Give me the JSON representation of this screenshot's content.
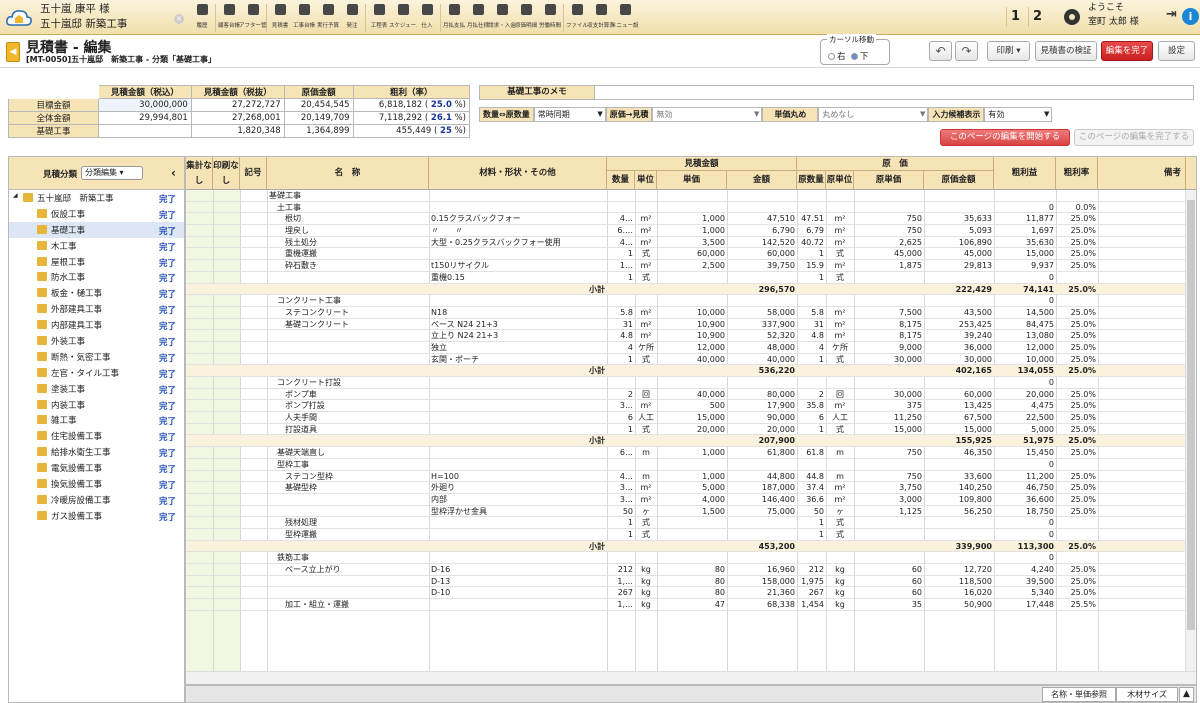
{
  "header": {
    "project_line1": "五十嵐 康平 様",
    "project_line2": "五十嵐邸 新築工事",
    "tools": [
      {
        "icon": "undo-icon",
        "label": "履歴"
      },
      {
        "icon": "customer-icon",
        "label": "顧客台帳"
      },
      {
        "icon": "list-icon",
        "label": "アフター管理"
      },
      {
        "icon": "document-icon",
        "label": "見積書"
      },
      {
        "icon": "house-icon",
        "label": "工事台帳"
      },
      {
        "icon": "calculator-icon",
        "label": "実行予算"
      },
      {
        "icon": "send-icon",
        "label": "発注"
      },
      {
        "icon": "table-icon",
        "label": "工程表"
      },
      {
        "icon": "calendar-icon",
        "label": "スケジュール"
      },
      {
        "icon": "cart-icon",
        "label": "仕入"
      },
      {
        "icon": "bank-icon",
        "label": "月払支払"
      },
      {
        "icon": "truck-icon",
        "label": "月払仕様"
      },
      {
        "icon": "invoice-icon",
        "label": "請求・入金"
      },
      {
        "icon": "tag-icon",
        "label": "原価明細"
      },
      {
        "icon": "car-icon",
        "label": "労働時間"
      },
      {
        "icon": "file-icon",
        "label": "ファイル"
      },
      {
        "icon": "calc-icon",
        "label": "収支計算表"
      },
      {
        "icon": "wrench-icon",
        "label": "メニュー設定"
      }
    ],
    "page_btn_1": "1",
    "page_btn_2": "2",
    "welcome": "ようこそ",
    "user": "室町 太郎 様"
  },
  "title": {
    "main": "見積書 - 編集",
    "sub": "[MT-0050]五十嵐邸　新築工事 - 分類「基礎工事」"
  },
  "cursor": {
    "label": "カーソル移動",
    "opt_right": "右",
    "opt_down": "下"
  },
  "buttons": {
    "print": "印刷 ▾",
    "verify": "見積書の検証",
    "finish": "編集を完了",
    "settings": "設定",
    "start_edit": "このページの編集を開始する",
    "end_edit": "このページの編集を完了する",
    "name_ref": "名称・単価参照",
    "wood_size": "木材サイズ"
  },
  "totals": {
    "headers": [
      "見積金額（税込）",
      "見積金額（税抜）",
      "原価金額",
      "粗利（率）"
    ],
    "rows": [
      {
        "label": "目標金額",
        "v1": "30,000,000",
        "v2": "27,272,727",
        "v3": "20,454,545",
        "v4": "6,818,182 (",
        "rate": "25.0",
        "pct": "%)"
      },
      {
        "label": "全体金額",
        "v1": "29,994,801",
        "v2": "27,268,001",
        "v3": "20,149,709",
        "v4": "7,118,292 (",
        "rate": "26.1",
        "pct": "%)"
      },
      {
        "label": "基礎工事",
        "v1": "",
        "v2": "1,820,348",
        "v3": "1,364,899",
        "v4": "455,449 (",
        "rate": "25",
        "pct": "%)"
      }
    ]
  },
  "memo": {
    "label": "基礎工事のメモ",
    "value": ""
  },
  "options": {
    "qty_label": "数量⇔原数量",
    "qty_value": "常時同期",
    "cost_label": "原価→見積",
    "cost_value": "無効",
    "round_label": "単価丸め",
    "round_value": "丸めなし",
    "input_label": "入力候補表示",
    "input_value": "有効"
  },
  "sidebar": {
    "title": "見積分類",
    "select": "分類編集 ▾",
    "root": "五十嵐邸　新築工事",
    "status": "完了",
    "items": [
      "仮設工事",
      "基礎工事",
      "木工事",
      "屋根工事",
      "防水工事",
      "板金・樋工事",
      "外部建具工事",
      "内部建具工事",
      "外装工事",
      "断熱・気密工事",
      "左官・タイル工事",
      "塗装工事",
      "内装工事",
      "雑工事",
      "住宅設備工事",
      "給排水衛生工事",
      "電気設備工事",
      "換気設備工事",
      "冷暖房設備工事",
      "ガス設備工事"
    ]
  },
  "grid_header": {
    "shuukei": "集計なし",
    "insatsu": "印刷なし",
    "kigo": "記号",
    "name": "名　称",
    "material": "材料・形状・その他",
    "mitsumori_group": "見積金額",
    "qty": "数量",
    "unit": "単位",
    "price": "単価",
    "amount": "金額",
    "genka_group": "原　価",
    "cqty": "原数量",
    "cunit": "原単位",
    "cprice": "原単価",
    "camount": "原価金額",
    "profit": "粗利益",
    "rate": "粗利率",
    "note": "備考"
  },
  "rows": [
    {
      "t": "n",
      "name": "基礎工事",
      "mat": "",
      "q": "",
      "u": "",
      "p": "",
      "a": "",
      "cq": "",
      "cu": "",
      "cp": "",
      "ca": "",
      "pr": "",
      "r": ""
    },
    {
      "t": "n",
      "name": "　土工事",
      "mat": "",
      "q": "",
      "u": "",
      "p": "",
      "a": "",
      "cq": "",
      "cu": "",
      "cp": "",
      "ca": "",
      "pr": "0",
      "r": "0.0%"
    },
    {
      "t": "n",
      "name": "　　根切",
      "mat": "0.15クラスバックフォー",
      "q": "4…",
      "u": "m²",
      "p": "1,000",
      "a": "47,510",
      "cq": "47.51",
      "cu": "m²",
      "cp": "750",
      "ca": "35,633",
      "pr": "11,877",
      "r": "25.0%"
    },
    {
      "t": "n",
      "name": "　　埋戻し",
      "mat": "〃　　〃",
      "q": "6.…",
      "u": "m²",
      "p": "1,000",
      "a": "6,790",
      "cq": "6.79",
      "cu": "m²",
      "cp": "750",
      "ca": "5,093",
      "pr": "1,697",
      "r": "25.0%"
    },
    {
      "t": "n",
      "name": "　　残土処分",
      "mat": "大型・0.25クラスバックフォー使用",
      "q": "4…",
      "u": "m²",
      "p": "3,500",
      "a": "142,520",
      "cq": "40.72",
      "cu": "m²",
      "cp": "2,625",
      "ca": "106,890",
      "pr": "35,630",
      "r": "25.0%"
    },
    {
      "t": "n",
      "name": "　　重機運搬",
      "mat": "",
      "q": "1",
      "u": "式",
      "p": "60,000",
      "a": "60,000",
      "cq": "1",
      "cu": "式",
      "cp": "45,000",
      "ca": "45,000",
      "pr": "15,000",
      "r": "25.0%"
    },
    {
      "t": "n",
      "name": "　　砕石敷き",
      "mat": "t150リサイクル",
      "q": "1…",
      "u": "m²",
      "p": "2,500",
      "a": "39,750",
      "cq": "15.9",
      "cu": "m²",
      "cp": "1,875",
      "ca": "29,813",
      "pr": "9,937",
      "r": "25.0%"
    },
    {
      "t": "n",
      "name": "",
      "mat": "重機0.15",
      "q": "1",
      "u": "式",
      "p": "",
      "a": "",
      "cq": "1",
      "cu": "式",
      "cp": "",
      "ca": "",
      "pr": "0",
      "r": ""
    },
    {
      "t": "s",
      "name": "",
      "mat": "小計",
      "q": "",
      "u": "",
      "p": "",
      "a": "296,570",
      "cq": "",
      "cu": "",
      "cp": "",
      "ca": "222,429",
      "pr": "74,141",
      "r": "25.0%"
    },
    {
      "t": "n",
      "name": "　コンクリート工事",
      "mat": "",
      "q": "",
      "u": "",
      "p": "",
      "a": "",
      "cq": "",
      "cu": "",
      "cp": "",
      "ca": "",
      "pr": "0",
      "r": ""
    },
    {
      "t": "n",
      "name": "　　ステコンクリート",
      "mat": "N18",
      "q": "5.8",
      "u": "m²",
      "p": "10,000",
      "a": "58,000",
      "cq": "5.8",
      "cu": "m²",
      "cp": "7,500",
      "ca": "43,500",
      "pr": "14,500",
      "r": "25.0%"
    },
    {
      "t": "n",
      "name": "　　基礎コンクリート",
      "mat": "ベース N24 21+3",
      "q": "31",
      "u": "m²",
      "p": "10,900",
      "a": "337,900",
      "cq": "31",
      "cu": "m²",
      "cp": "8,175",
      "ca": "253,425",
      "pr": "84,475",
      "r": "25.0%"
    },
    {
      "t": "n",
      "name": "",
      "mat": "立上り N24 21+3",
      "q": "4.8",
      "u": "m²",
      "p": "10,900",
      "a": "52,320",
      "cq": "4.8",
      "cu": "m²",
      "cp": "8,175",
      "ca": "39,240",
      "pr": "13,080",
      "r": "25.0%"
    },
    {
      "t": "n",
      "name": "",
      "mat": "独立",
      "q": "4",
      "u": "ケ所",
      "p": "12,000",
      "a": "48,000",
      "cq": "4",
      "cu": "ケ所",
      "cp": "9,000",
      "ca": "36,000",
      "pr": "12,000",
      "r": "25.0%"
    },
    {
      "t": "n",
      "name": "",
      "mat": "玄関・ポーチ",
      "q": "1",
      "u": "式",
      "p": "40,000",
      "a": "40,000",
      "cq": "1",
      "cu": "式",
      "cp": "30,000",
      "ca": "30,000",
      "pr": "10,000",
      "r": "25.0%"
    },
    {
      "t": "s",
      "name": "",
      "mat": "小計",
      "q": "",
      "u": "",
      "p": "",
      "a": "536,220",
      "cq": "",
      "cu": "",
      "cp": "",
      "ca": "402,165",
      "pr": "134,055",
      "r": "25.0%"
    },
    {
      "t": "n",
      "name": "　コンクリート打設",
      "mat": "",
      "q": "",
      "u": "",
      "p": "",
      "a": "",
      "cq": "",
      "cu": "",
      "cp": "",
      "ca": "",
      "pr": "0",
      "r": ""
    },
    {
      "t": "n",
      "name": "　　ポンプ車",
      "mat": "",
      "q": "2",
      "u": "回",
      "p": "40,000",
      "a": "80,000",
      "cq": "2",
      "cu": "回",
      "cp": "30,000",
      "ca": "60,000",
      "pr": "20,000",
      "r": "25.0%"
    },
    {
      "t": "n",
      "name": "　　ポンプ打設",
      "mat": "",
      "q": "3…",
      "u": "m²",
      "p": "500",
      "a": "17,900",
      "cq": "35.8",
      "cu": "m²",
      "cp": "375",
      "ca": "13,425",
      "pr": "4,475",
      "r": "25.0%"
    },
    {
      "t": "n",
      "name": "　　人夫手間",
      "mat": "",
      "q": "6",
      "u": "人工",
      "p": "15,000",
      "a": "90,000",
      "cq": "6",
      "cu": "人工",
      "cp": "11,250",
      "ca": "67,500",
      "pr": "22,500",
      "r": "25.0%"
    },
    {
      "t": "n",
      "name": "　　打設道具",
      "mat": "",
      "q": "1",
      "u": "式",
      "p": "20,000",
      "a": "20,000",
      "cq": "1",
      "cu": "式",
      "cp": "15,000",
      "ca": "15,000",
      "pr": "5,000",
      "r": "25.0%"
    },
    {
      "t": "s",
      "name": "",
      "mat": "小計",
      "q": "",
      "u": "",
      "p": "",
      "a": "207,900",
      "cq": "",
      "cu": "",
      "cp": "",
      "ca": "155,925",
      "pr": "51,975",
      "r": "25.0%"
    },
    {
      "t": "n",
      "name": "　基礎天端直し",
      "mat": "",
      "q": "6…",
      "u": "m",
      "p": "1,000",
      "a": "61,800",
      "cq": "61.8",
      "cu": "m",
      "cp": "750",
      "ca": "46,350",
      "pr": "15,450",
      "r": "25.0%"
    },
    {
      "t": "n",
      "name": "　型枠工事",
      "mat": "",
      "q": "",
      "u": "",
      "p": "",
      "a": "",
      "cq": "",
      "cu": "",
      "cp": "",
      "ca": "",
      "pr": "0",
      "r": ""
    },
    {
      "t": "n",
      "name": "　　ステコン型枠",
      "mat": "H=100",
      "q": "4…",
      "u": "m",
      "p": "1,000",
      "a": "44,800",
      "cq": "44.8",
      "cu": "m",
      "cp": "750",
      "ca": "33,600",
      "pr": "11,200",
      "r": "25.0%"
    },
    {
      "t": "n",
      "name": "　　基礎型枠",
      "mat": "外廻り",
      "q": "3…",
      "u": "m²",
      "p": "5,000",
      "a": "187,000",
      "cq": "37.4",
      "cu": "m²",
      "cp": "3,750",
      "ca": "140,250",
      "pr": "46,750",
      "r": "25.0%"
    },
    {
      "t": "n",
      "name": "",
      "mat": "内部",
      "q": "3…",
      "u": "m²",
      "p": "4,000",
      "a": "146,400",
      "cq": "36.6",
      "cu": "m²",
      "cp": "3,000",
      "ca": "109,800",
      "pr": "36,600",
      "r": "25.0%"
    },
    {
      "t": "n",
      "name": "",
      "mat": "型枠浮かせ金具",
      "q": "50",
      "u": "ヶ",
      "p": "1,500",
      "a": "75,000",
      "cq": "50",
      "cu": "ヶ",
      "cp": "1,125",
      "ca": "56,250",
      "pr": "18,750",
      "r": "25.0%"
    },
    {
      "t": "n",
      "name": "　　残材処理",
      "mat": "",
      "q": "1",
      "u": "式",
      "p": "",
      "a": "",
      "cq": "1",
      "cu": "式",
      "cp": "",
      "ca": "",
      "pr": "0",
      "r": ""
    },
    {
      "t": "n",
      "name": "　　型枠運搬",
      "mat": "",
      "q": "1",
      "u": "式",
      "p": "",
      "a": "",
      "cq": "1",
      "cu": "式",
      "cp": "",
      "ca": "",
      "pr": "0",
      "r": ""
    },
    {
      "t": "s",
      "name": "",
      "mat": "小計",
      "q": "",
      "u": "",
      "p": "",
      "a": "453,200",
      "cq": "",
      "cu": "",
      "cp": "",
      "ca": "339,900",
      "pr": "113,300",
      "r": "25.0%"
    },
    {
      "t": "n",
      "name": "　鉄筋工事",
      "mat": "",
      "q": "",
      "u": "",
      "p": "",
      "a": "",
      "cq": "",
      "cu": "",
      "cp": "",
      "ca": "",
      "pr": "0",
      "r": ""
    },
    {
      "t": "n",
      "name": "　　ベース立上がり",
      "mat": "D-16",
      "q": "212",
      "u": "kg",
      "p": "80",
      "a": "16,960",
      "cq": "212",
      "cu": "kg",
      "cp": "60",
      "ca": "12,720",
      "pr": "4,240",
      "r": "25.0%"
    },
    {
      "t": "n",
      "name": "",
      "mat": "D-13",
      "q": "1,…",
      "u": "kg",
      "p": "80",
      "a": "158,000",
      "cq": "1,975",
      "cu": "kg",
      "cp": "60",
      "ca": "118,500",
      "pr": "39,500",
      "r": "25.0%"
    },
    {
      "t": "n",
      "name": "",
      "mat": "D-10",
      "q": "267",
      "u": "kg",
      "p": "80",
      "a": "21,360",
      "cq": "267",
      "cu": "kg",
      "cp": "60",
      "ca": "16,020",
      "pr": "5,340",
      "r": "25.0%"
    },
    {
      "t": "n",
      "name": "　　加工・組立・運搬",
      "mat": "",
      "q": "1,…",
      "u": "kg",
      "p": "47",
      "a": "68,338",
      "cq": "1,454",
      "cu": "kg",
      "cp": "35",
      "ca": "50,900",
      "pr": "17,448",
      "r": "25.5%"
    }
  ]
}
